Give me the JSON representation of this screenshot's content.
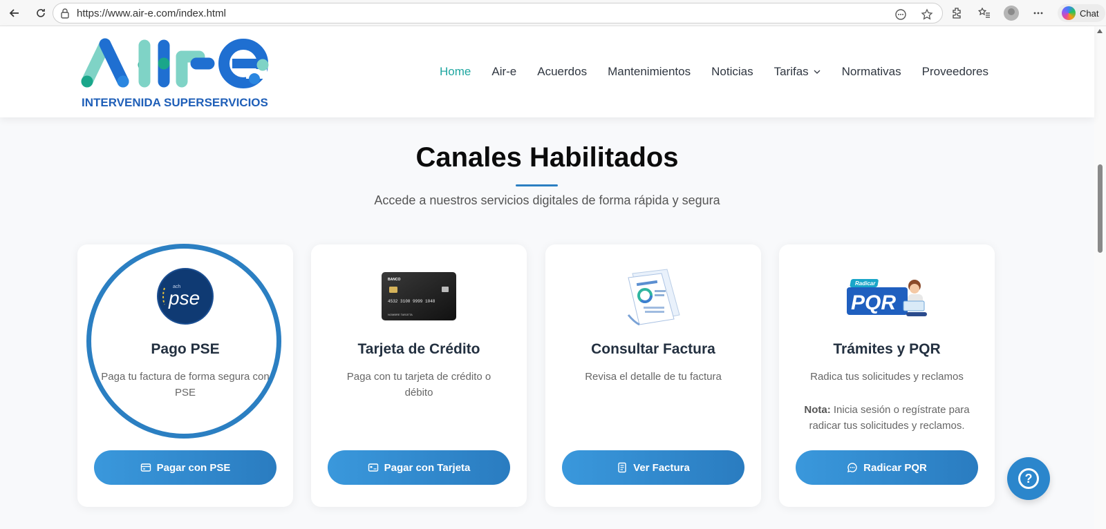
{
  "browser": {
    "url": "https://www.air-e.com/index.html",
    "chat_label": "Chat"
  },
  "logo": {
    "text": "Air-e",
    "tagline": "INTERVENIDA SUPERSERVICIOS"
  },
  "nav": {
    "items": [
      "Home",
      "Air-e",
      "Acuerdos",
      "Mantenimientos",
      "Noticias",
      "Tarifas",
      "Normativas",
      "Proveedores"
    ]
  },
  "section": {
    "title": "Canales Habilitados",
    "subtitle": "Accede a nuestros servicios digitales de forma rápida y segura"
  },
  "cards": [
    {
      "title": "Pago PSE",
      "desc": "Paga tu factura de forma segura con PSE",
      "button": "Pagar con PSE",
      "icon": "credit-card-icon"
    },
    {
      "title": "Tarjeta de Crédito",
      "desc": "Paga con tu tarjeta de crédito o débito",
      "button": "Pagar con Tarjeta",
      "icon": "card-icon"
    },
    {
      "title": "Consultar Factura",
      "desc": "Revisa el detalle de tu factura",
      "button": "Ver Factura",
      "icon": "document-icon"
    },
    {
      "title": "Trámites y PQR",
      "desc": "Radica tus solicitudes y reclamos",
      "note_label": "Nota:",
      "note_text": " Inicia sesión o regístrate para radicar tus solicitudes y reclamos.",
      "button": "Radicar PQR",
      "icon": "chat-icon"
    }
  ],
  "card_images": {
    "pse_text": "pse",
    "pse_small": "ach",
    "bank_card_bank": "BANCO",
    "bank_card_number": "4532 3100 9999 1048",
    "bank_card_name": "NOMBRE TARJETA",
    "pqr_radicar": "Radicar",
    "pqr_text": "PQR"
  },
  "colors": {
    "accent": "#2b7fc2",
    "nav_active": "#1ea6a0",
    "logo_teal": "#7fd3c6",
    "logo_blue": "#1f6fd1"
  }
}
